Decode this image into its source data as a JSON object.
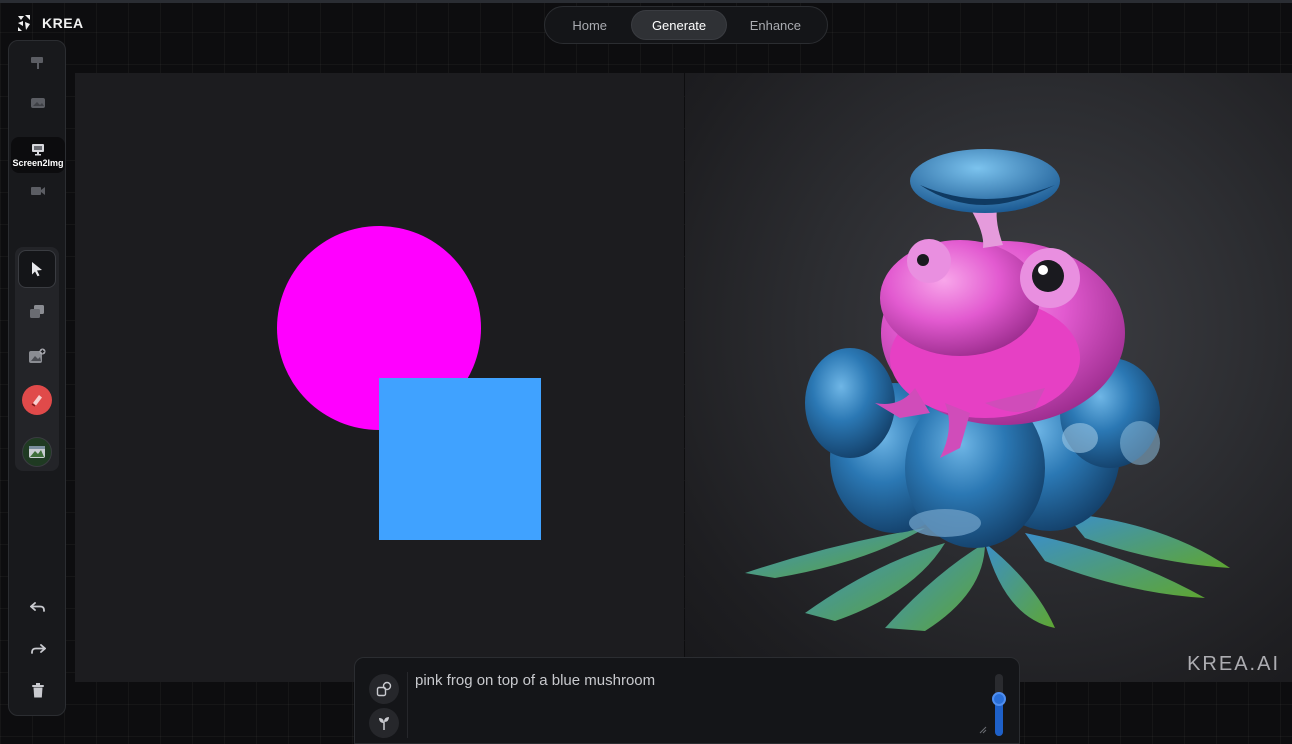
{
  "app": {
    "brand": "KREA"
  },
  "nav": {
    "tabs": [
      {
        "label": "Home",
        "active": false
      },
      {
        "label": "Generate",
        "active": true
      },
      {
        "label": "Enhance",
        "active": false
      }
    ]
  },
  "sidebar": {
    "modes": [
      {
        "icon": "flag-icon",
        "label": ""
      },
      {
        "icon": "image-icon",
        "label": ""
      },
      {
        "icon": "screen-monitor-icon",
        "label": "Screen2Img",
        "active": true
      },
      {
        "icon": "video-camera-icon",
        "label": ""
      }
    ],
    "tools": [
      {
        "icon": "cursor-arrow-icon",
        "active": true
      },
      {
        "icon": "layers-icon"
      },
      {
        "icon": "add-image-icon"
      },
      {
        "icon": "eraser-icon",
        "color": "#e04a4a"
      },
      {
        "icon": "image-thumbnail-icon"
      }
    ],
    "history": [
      {
        "icon": "undo-icon"
      },
      {
        "icon": "redo-icon"
      },
      {
        "icon": "trash-icon"
      }
    ]
  },
  "canvas": {
    "background": "#1c1c1f",
    "shapes": [
      {
        "type": "circle",
        "color": "#ff00ff"
      },
      {
        "type": "square",
        "color": "#40a2ff"
      }
    ]
  },
  "output": {
    "subject": "pink frog on blue mushroom",
    "watermark": "KREA.AI"
  },
  "prompt": {
    "text": "pink frog on top of a blue mushroom",
    "icons": [
      "style-transfer-icon",
      "sprout-icon"
    ],
    "strength": 0.6,
    "accent": "#2a6fd8"
  }
}
